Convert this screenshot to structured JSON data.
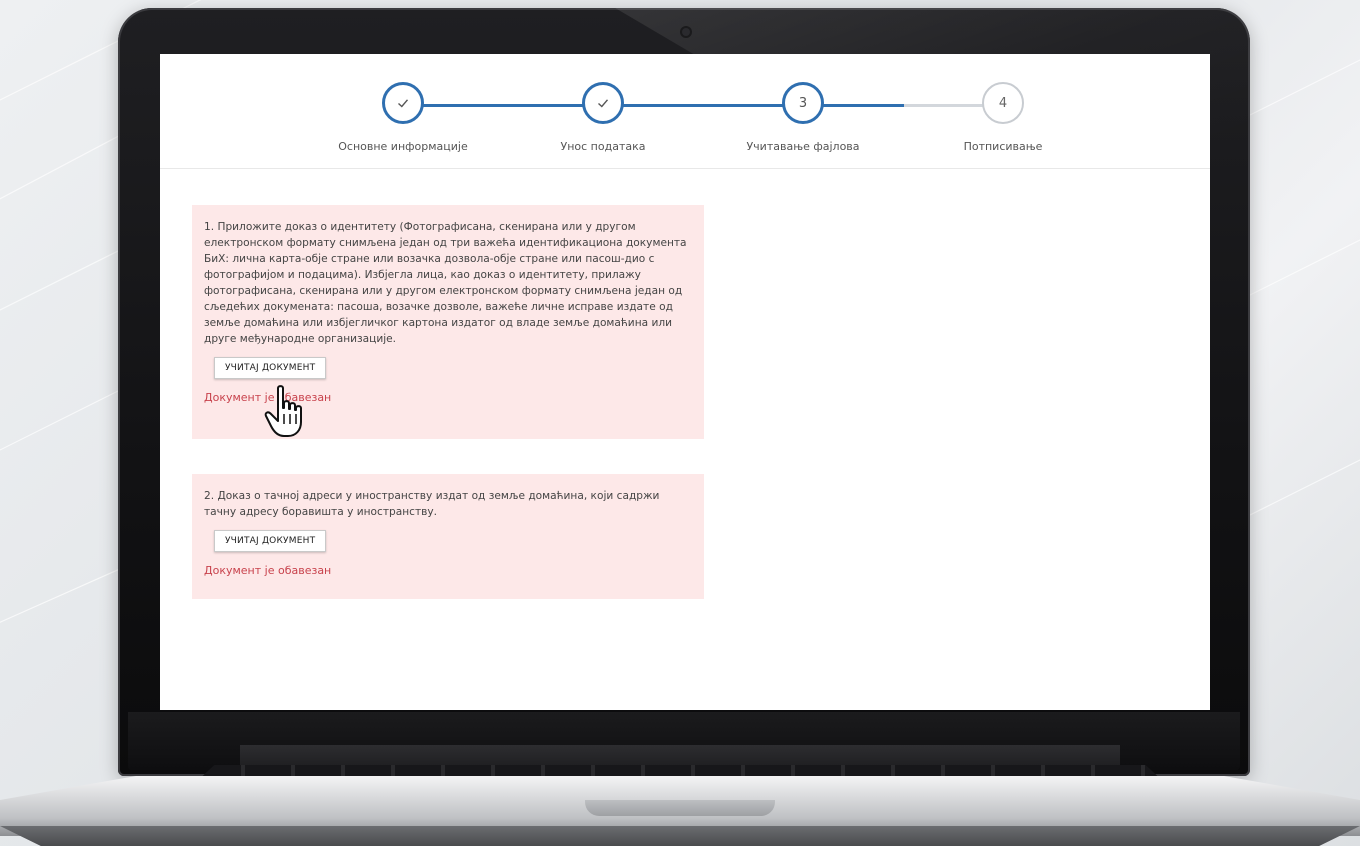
{
  "stepper": {
    "steps": [
      {
        "label": "Основне информације",
        "state": "done",
        "marker": "✓"
      },
      {
        "label": "Унос података",
        "state": "done",
        "marker": "✓"
      },
      {
        "label": "Учитавање фајлова",
        "state": "active",
        "marker": "3"
      },
      {
        "label": "Потписивање",
        "state": "todo",
        "marker": "4"
      }
    ],
    "active_color": "#2f6fb0",
    "inactive_color": "#d3d7dc"
  },
  "cards": [
    {
      "text": "1. Приложите доказ о идентитету (Фотографисана, скенирана или у другом електронском формату снимљена један од три важећа идентификациона документа БиХ: лична карта-обје стране или возачка дозвола-обје стране или пасош-дио с фотографијом и подацима). Избјегла лица, као доказ о идентитету, прилажу фотографисана, скенирана или у другом електронском формату снимљена један од сљедећих докумената: пасоша, возачке дозволе, важеће личне исправе издате од земље домаћина или избјегличког картона издатог од владе земље домаћина или друге међународне организације.",
      "button_label": "УЧИТАЈ ДОКУМЕНТ",
      "status": "Документ је обавезан"
    },
    {
      "text": "2. Доказ о тачној адреси у иностранству издат од земље домаћина, који садржи тачну адресу боравишта у иностранству.",
      "button_label": "УЧИТАЈ ДОКУМЕНТ",
      "status": "Документ је обавезан"
    }
  ],
  "colors": {
    "card_background": "#fde8e8",
    "status_text": "#c8424c"
  },
  "icons": {
    "cursor": "hand-pointer-icon",
    "step_done": "checkmark-icon"
  }
}
